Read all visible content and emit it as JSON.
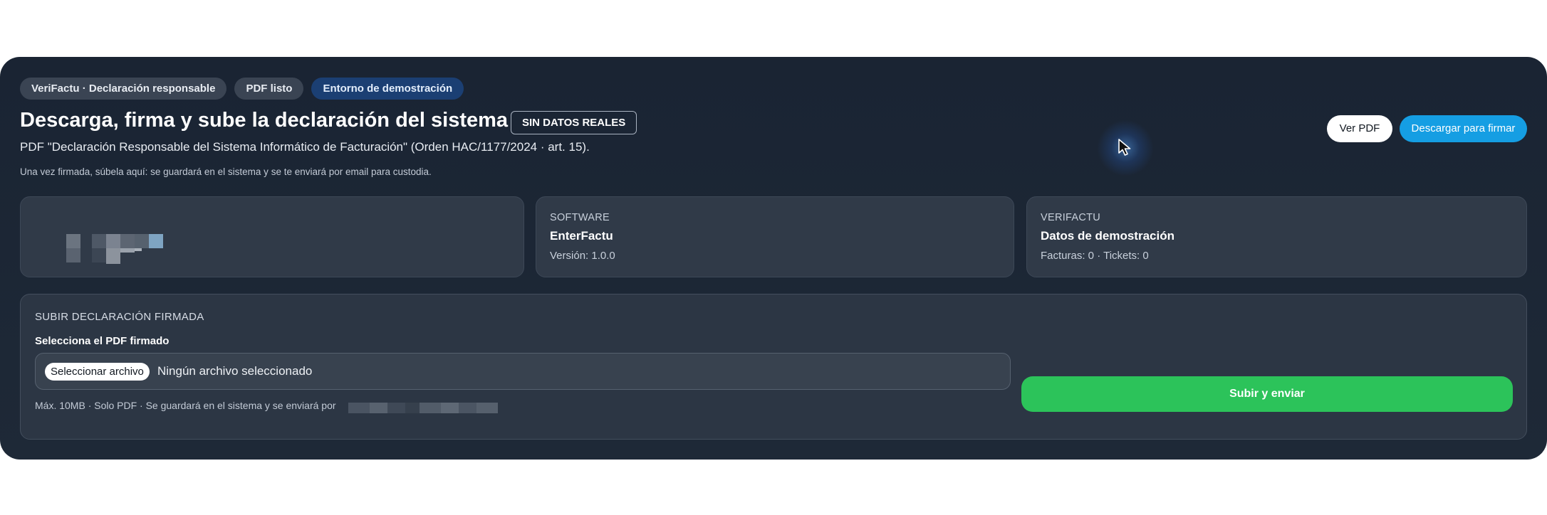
{
  "badges": [
    "VeriFactu · Declaración responsable",
    "PDF listo",
    "Entorno de demostración"
  ],
  "header": {
    "title": "Descarga, firma y sube la declaración del sistema",
    "tag": "SIN DATOS REALES",
    "subtitle": "PDF \"Declaración Responsable del Sistema Informático de Facturación\" (Orden HAC/1177/2024 · art. 15).",
    "note": "Una vez firmada, súbela aquí: se guardará en el sistema y se te enviará por email para custodia."
  },
  "actions": {
    "view_pdf": "Ver PDF",
    "download": "Descargar para firmar"
  },
  "cards": {
    "software": {
      "label": "SOFTWARE",
      "value": "EnterFactu",
      "meta": "Versión: 1.0.0"
    },
    "verifactu": {
      "label": "VERIFACTU",
      "value": "Datos de demostración",
      "meta": "Facturas: 0 · Tickets: 0"
    }
  },
  "upload": {
    "label": "SUBIR DECLARACIÓN FIRMADA",
    "field_label": "Selecciona el PDF firmado",
    "file_button": "Seleccionar archivo",
    "file_status": "Ningún archivo seleccionado",
    "hint": "Máx. 10MB · Solo PDF · Se guardará en el sistema y se enviará por",
    "submit": "Subir y enviar"
  },
  "icons": {
    "pointer": "cursor-arrow-icon"
  },
  "colors": {
    "background": "#1a2433",
    "card": "#303a48",
    "accent_blue": "#159ee3",
    "success_green": "#2cc35a",
    "badge_blue": "#1b3f73"
  }
}
